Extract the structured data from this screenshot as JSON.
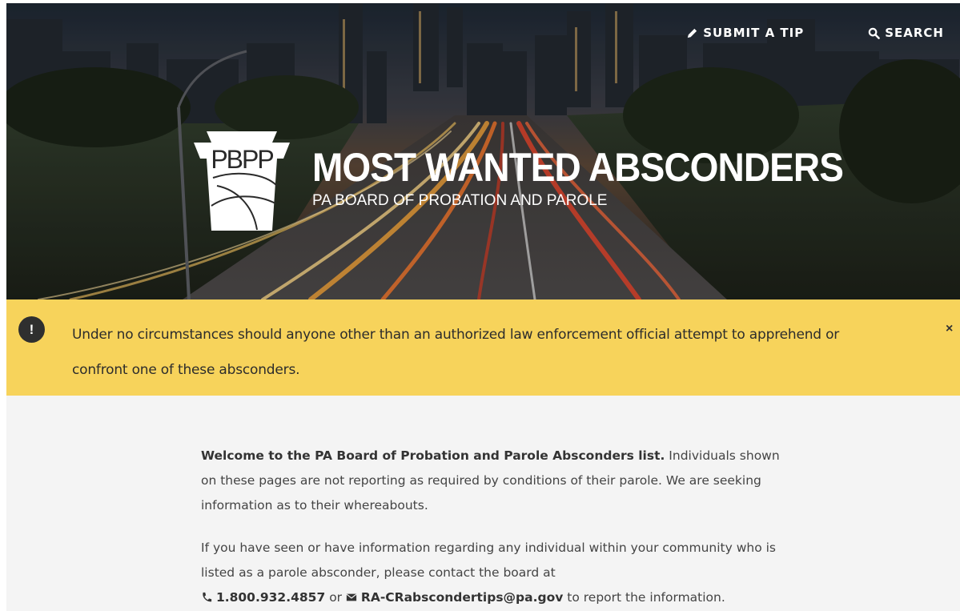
{
  "nav": {
    "submit_tip": "SUBMIT A TIP",
    "search": "SEARCH"
  },
  "brand": {
    "logo_text": "PBPP",
    "title": "MOST WANTED ABSCONDERS",
    "subtitle": "PA BOARD OF PROBATION AND PAROLE"
  },
  "alert": {
    "icon": "!",
    "text": "Under no circumstances should anyone other than an authorized law enforcement official attempt to apprehend or confront one of these absconders.",
    "close": "×",
    "color": "#f7d35b"
  },
  "intro": {
    "lead_bold": "Welcome to the PA Board of Probation and Parole Absconders list.",
    "lead_rest": " Individuals shown on these pages are not reporting as required by conditions of their parole. We are seeking information as to their whereabouts.",
    "para2": "If you have seen or have information regarding any individual within your community who is listed as a parole absconder, please contact the board at",
    "phone": "1.800.932.4857",
    "or": "or",
    "email": "RA-CRabscondertips@pa.gov",
    "tail": "to report the information."
  }
}
